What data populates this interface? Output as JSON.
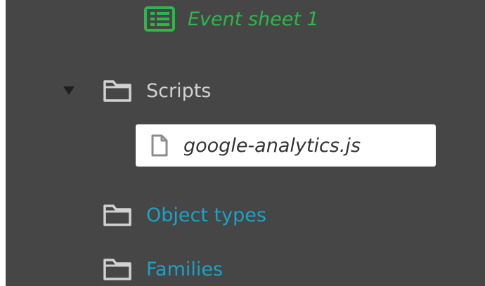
{
  "project_tree": {
    "event_sheet": {
      "label": "Event sheet 1",
      "icon": "event-sheet-icon",
      "color": "#2bb94a"
    },
    "scripts_folder": {
      "label": "Scripts",
      "expanded": true,
      "icon": "folder-icon",
      "toggle_icon": "triangle-down-icon",
      "children": [
        {
          "label": "google-analytics.js",
          "icon": "file-icon",
          "selected": true
        }
      ]
    },
    "object_types_folder": {
      "label": "Object types",
      "icon": "folder-icon",
      "color": "#1ba3c6"
    },
    "families_folder": {
      "label": "Families",
      "icon": "folder-icon",
      "color": "#1ba3c6"
    }
  },
  "colors": {
    "panel_background": "#464646",
    "selection_background": "#ffffff",
    "folder_text": "#d2d2d2",
    "link_text": "#1ba3c6"
  }
}
